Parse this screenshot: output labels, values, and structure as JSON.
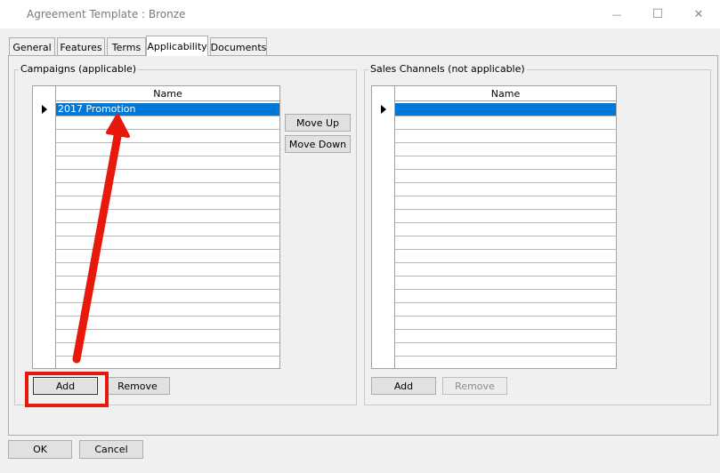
{
  "window": {
    "title": "Agreement Template : Bronze",
    "minimize_glyph": "—",
    "maximize_glyph": "☐",
    "close_glyph": "✕"
  },
  "tabs": [
    {
      "label": "General",
      "active": false
    },
    {
      "label": "Features",
      "active": false
    },
    {
      "label": "Terms",
      "active": false
    },
    {
      "label": "Applicability",
      "active": true
    },
    {
      "label": "Documents",
      "active": false
    }
  ],
  "campaigns": {
    "legend": "Campaigns (applicable)",
    "column_header": "Name",
    "rows": [
      "2017 Promotion"
    ],
    "selected_row": 0,
    "add_label": "Add",
    "remove_label": "Remove",
    "move_up_label": "Move Up",
    "move_down_label": "Move Down"
  },
  "sales_channels": {
    "legend": "Sales Channels (not applicable)",
    "column_header": "Name",
    "rows": [
      ""
    ],
    "selected_row": 0,
    "add_label": "Add",
    "remove_label": "Remove",
    "remove_disabled": true
  },
  "footer": {
    "ok_label": "OK",
    "cancel_label": "Cancel"
  },
  "colors": {
    "selection": "#0078d7",
    "annotation": "#e8180c"
  }
}
